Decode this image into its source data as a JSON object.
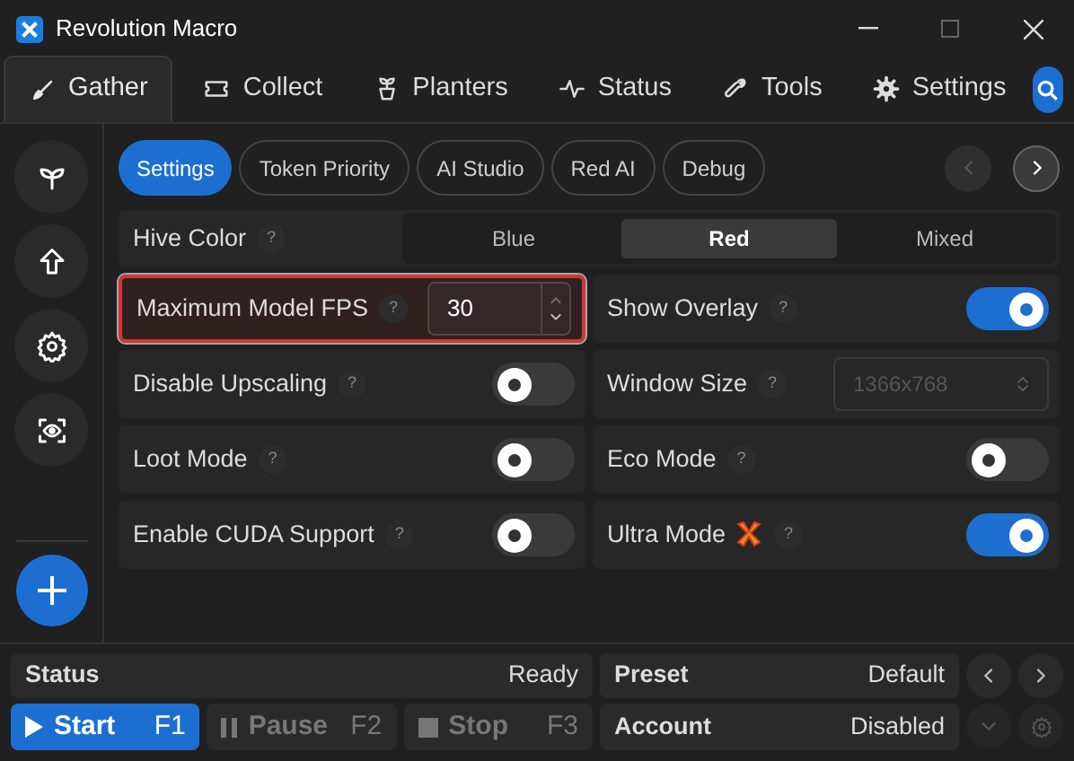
{
  "window": {
    "title": "Revolution Macro"
  },
  "tabs": [
    {
      "label": "Gather",
      "selected": true
    },
    {
      "label": "Collect",
      "selected": false
    },
    {
      "label": "Planters",
      "selected": false
    },
    {
      "label": "Status",
      "selected": false
    },
    {
      "label": "Tools",
      "selected": false
    },
    {
      "label": "Settings",
      "selected": false
    }
  ],
  "subtabs": [
    {
      "label": "Settings",
      "selected": true
    },
    {
      "label": "Token Priority",
      "selected": false
    },
    {
      "label": "AI Studio",
      "selected": false
    },
    {
      "label": "Red AI",
      "selected": false
    },
    {
      "label": "Debug",
      "selected": false
    }
  ],
  "subtab_nav": {
    "previous_disabled": true
  },
  "hive_color": {
    "label": "Hive Color",
    "help": "?",
    "options": [
      {
        "label": "Blue",
        "selected": false
      },
      {
        "label": "Red",
        "selected": true
      },
      {
        "label": "Mixed",
        "selected": false
      }
    ]
  },
  "settings": [
    {
      "kind": "number",
      "label": "Maximum Model FPS",
      "help": "?",
      "value": "30",
      "highlighted": true
    },
    {
      "kind": "toggle",
      "label": "Show Overlay",
      "help": "?",
      "on": true,
      "highlighted": false
    },
    {
      "kind": "toggle",
      "label": "Disable Upscaling",
      "help": "?",
      "on": false,
      "highlighted": false
    },
    {
      "kind": "select",
      "label": "Window Size",
      "help": "?",
      "value": "1366x768",
      "disabled": true,
      "highlighted": false
    },
    {
      "kind": "toggle",
      "label": "Loot Mode",
      "help": "?",
      "on": false,
      "highlighted": false
    },
    {
      "kind": "toggle",
      "label": "Eco Mode",
      "help": "?",
      "on": false,
      "highlighted": false
    },
    {
      "kind": "toggle",
      "label": "Enable CUDA Support",
      "help": "?",
      "on": false,
      "highlighted": false
    },
    {
      "kind": "toggle",
      "label": "Ultra Mode",
      "help": "?",
      "on": true,
      "badge": true,
      "highlighted": false
    }
  ],
  "status": {
    "label": "Status",
    "value": "Ready"
  },
  "preset": {
    "label": "Preset",
    "value": "Default"
  },
  "account": {
    "label": "Account",
    "value": "Disabled"
  },
  "controls": [
    {
      "kind": "start",
      "label": "Start",
      "key": "F1",
      "disabled": false
    },
    {
      "kind": "pause",
      "label": "Pause",
      "key": "F2",
      "disabled": true
    },
    {
      "kind": "stop",
      "label": "Stop",
      "key": "F3",
      "disabled": true
    }
  ]
}
